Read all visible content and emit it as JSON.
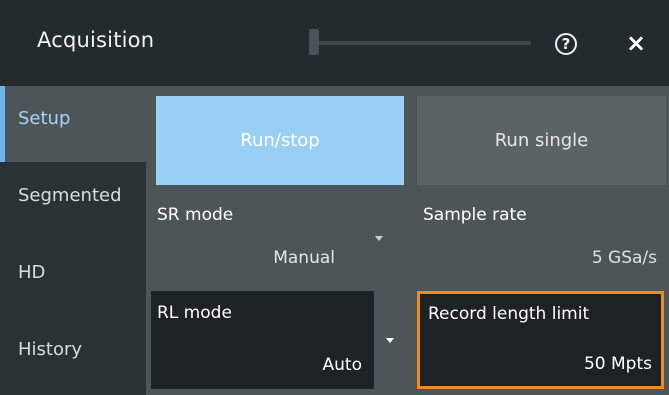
{
  "window": {
    "title": "Acquisition",
    "help_icon": "help-icon",
    "help_glyph": "?",
    "close_icon": "close-icon",
    "close_glyph": "×"
  },
  "sidebar": {
    "items": [
      {
        "label": "Setup",
        "active": true
      },
      {
        "label": "Segmented",
        "active": false
      },
      {
        "label": "HD",
        "active": false
      },
      {
        "label": "History",
        "active": false
      }
    ]
  },
  "buttons": {
    "run_stop": "Run/stop",
    "run_single": "Run single"
  },
  "fields": {
    "sr_mode": {
      "label": "SR mode",
      "value": "Manual"
    },
    "sample_rate": {
      "label": "Sample rate",
      "value": "5  GSa/s"
    },
    "rl_mode": {
      "label": "RL mode",
      "value": "Auto"
    },
    "record_length_limit": {
      "label": "Record length limit",
      "value": "50  Mpts"
    }
  },
  "colors": {
    "accent": "#99cff5",
    "active_tab_marker": "#6ab8ee",
    "highlight_border": "#ef8a1e",
    "panel": "#4d5559",
    "dark": "#1d2225"
  }
}
